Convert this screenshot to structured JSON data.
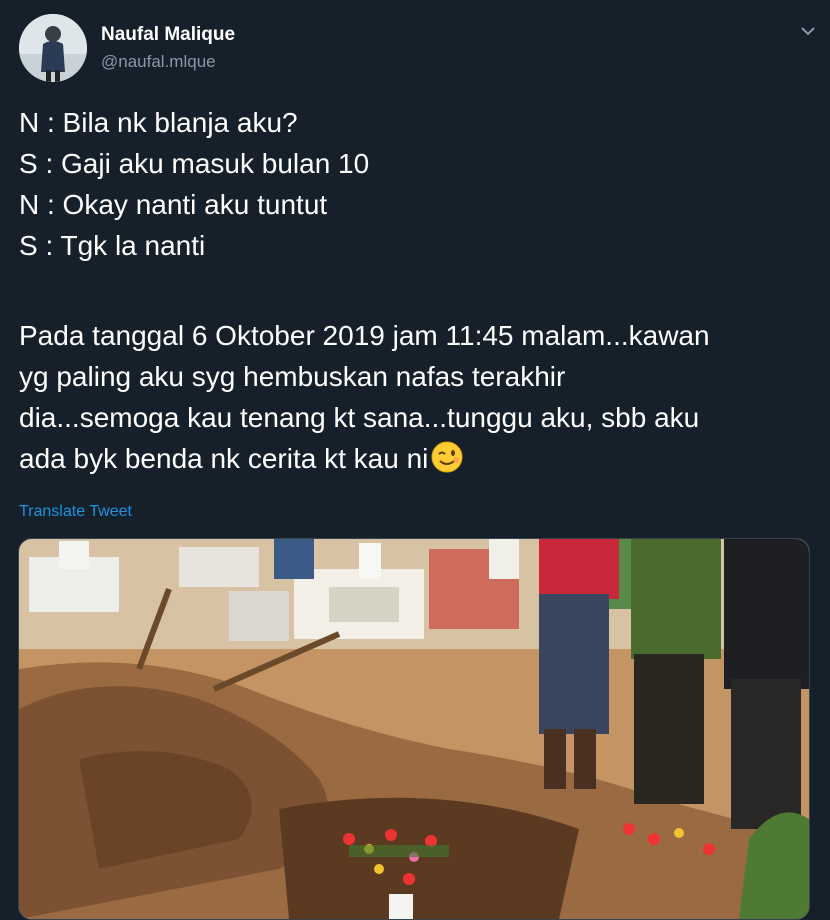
{
  "user": {
    "display_name": "Naufal Malique",
    "handle": "@naufal.mlque",
    "avatar": "profile-photo"
  },
  "tweet": {
    "lines": [
      "N : Bila nk blanja aku?",
      "S : Gaji aku masuk bulan 10",
      "N : Okay nanti aku tuntut",
      "S : Tgk la nanti",
      "",
      "Pada tanggal 6 Oktober 2019 jam 11:45 malam...kawan",
      "yg paling aku syg hembuskan nafas terakhir",
      "dia...semoga kau tenang kt sana...tunggu aku, sbb aku",
      "ada byk benda nk cerita kt kau ni"
    ],
    "emoji": "winking-face-emoji",
    "translate_label": "Translate Tweet"
  },
  "media": {
    "type": "photo",
    "subject": "grave-site-photo"
  },
  "icons": {
    "more": "chevron-down-icon"
  },
  "colors": {
    "background": "#15202b",
    "text": "#ffffff",
    "secondary": "#8899a6",
    "link": "#1b95e0"
  }
}
